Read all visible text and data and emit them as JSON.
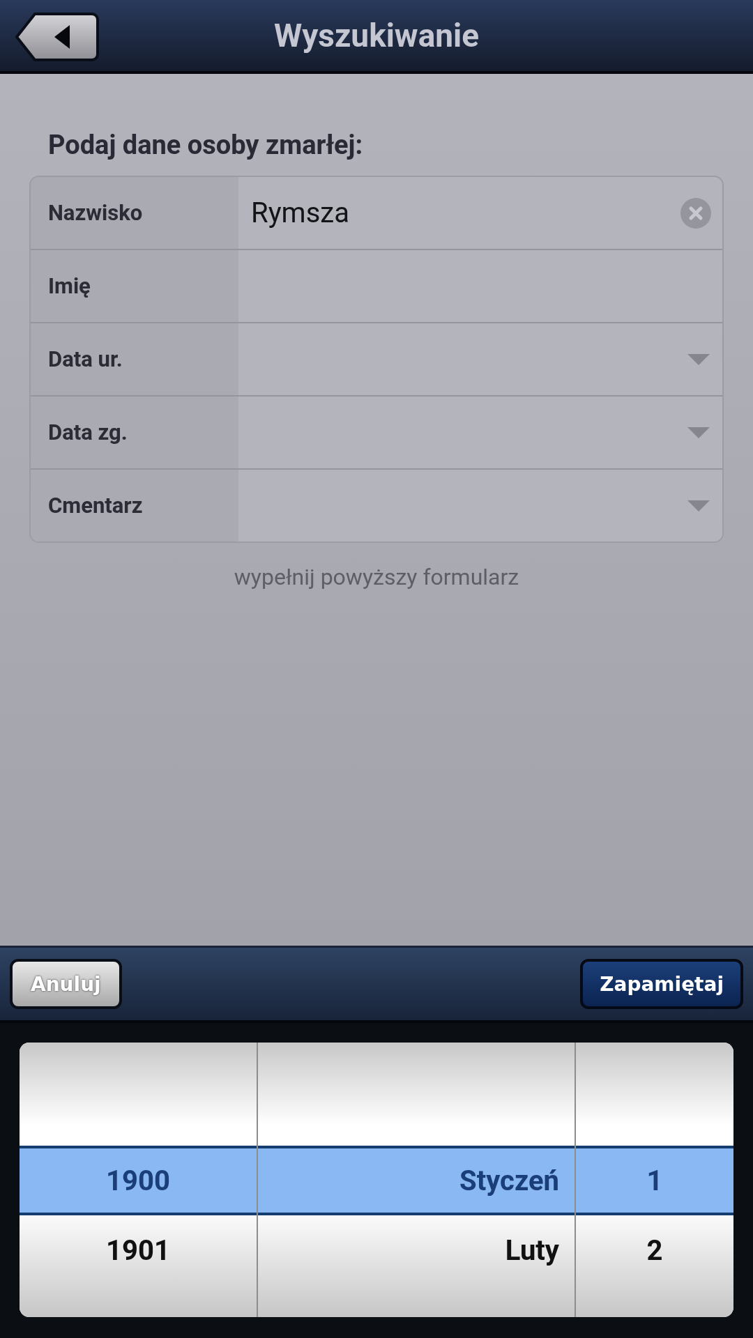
{
  "header": {
    "title": "Wyszukiwanie"
  },
  "form": {
    "heading": "Podaj dane osoby zmarłej:",
    "fields": [
      {
        "kind": "text",
        "label": "Nazwisko",
        "value": "Rymsza"
      },
      {
        "kind": "text",
        "label": "Imię"
      },
      {
        "kind": "select",
        "label": "Data ur."
      },
      {
        "kind": "select",
        "label": "Data zg."
      },
      {
        "kind": "select",
        "label": "Cmentarz"
      }
    ],
    "hint": "wypełnij powyższy formularz"
  },
  "toolbar": {
    "cancel": "Anuluj",
    "save": "Zapamiętaj"
  },
  "picker": {
    "columns": [
      {
        "kind": "year",
        "items": [
          {
            "label": "1900",
            "selected": true
          },
          {
            "label": "1901",
            "selected": false
          }
        ]
      },
      {
        "kind": "month",
        "items": [
          {
            "label": "Styczeń",
            "selected": true
          },
          {
            "label": "Luty",
            "selected": false
          }
        ]
      },
      {
        "kind": "day",
        "items": [
          {
            "label": "1",
            "selected": true
          },
          {
            "label": "2",
            "selected": false
          }
        ]
      }
    ]
  }
}
